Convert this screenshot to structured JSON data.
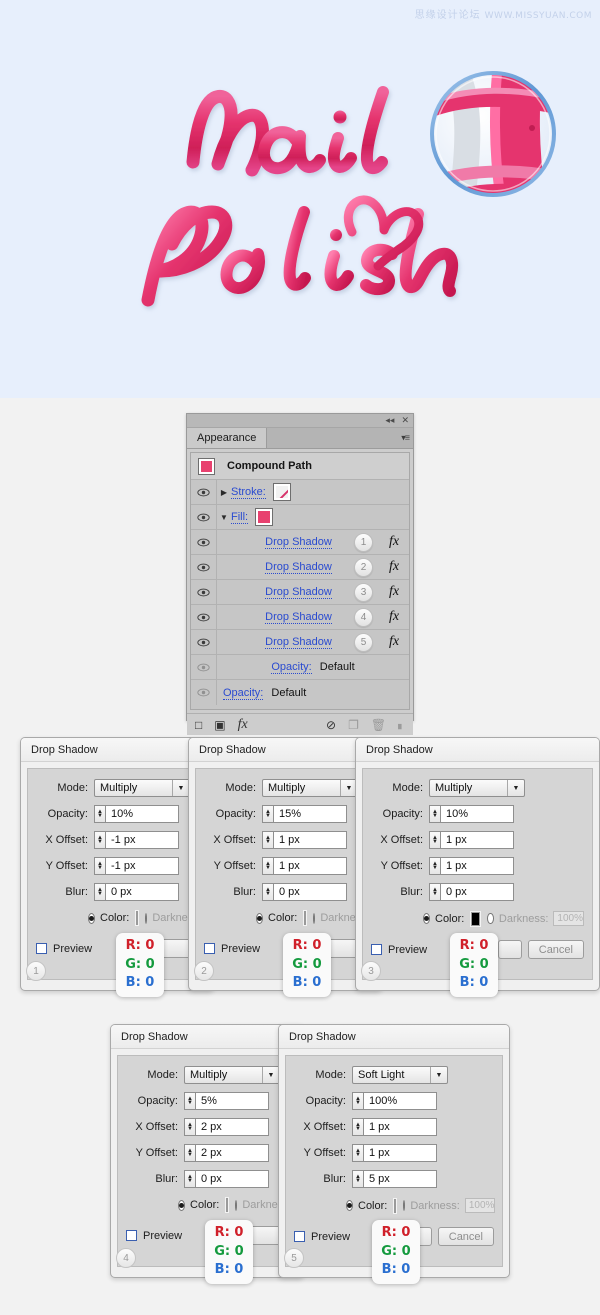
{
  "canvas": {
    "watermark_cn": "思缘设计论坛",
    "watermark_url": "WWW.MISSYUAN.COM",
    "artwork_line1": "Nail",
    "artwork_line2": "Polish",
    "background_color": "#e7effc",
    "lettering_color": "#e5346e"
  },
  "panel": {
    "tab_label": "Appearance",
    "collapse_icon": "◂◂",
    "close_icon": "✕",
    "menu_icon": "▾≡",
    "object_title": "Compound Path",
    "stroke_label": "Stroke:",
    "fill_label": "Fill:",
    "effects": [
      {
        "label": "Drop Shadow",
        "badge": "1",
        "fx": "fx"
      },
      {
        "label": "Drop Shadow",
        "badge": "2",
        "fx": "fx"
      },
      {
        "label": "Drop Shadow",
        "badge": "3",
        "fx": "fx"
      },
      {
        "label": "Drop Shadow",
        "badge": "4",
        "fx": "fx"
      },
      {
        "label": "Drop Shadow",
        "badge": "5",
        "fx": "fx"
      }
    ],
    "opacity_rows": [
      {
        "label": "Opacity:",
        "value": "Default"
      },
      {
        "label": "Opacity:",
        "value": "Default"
      }
    ],
    "footer_icons": [
      "new-stroke-icon",
      "new-fill-icon",
      "add-effect-icon",
      "clear-appearance-icon",
      "duplicate-item-icon",
      "delete-item-icon",
      "resize-grip-icon"
    ],
    "footer_glyphs": {
      "new_stroke": "□",
      "new_fill": "▣",
      "add_effect": "fx",
      "clear": "⊘",
      "duplicate": "❐",
      "delete": "Ὕ1",
      "grip": "∷"
    }
  },
  "dialog_fields": {
    "mode_label": "Mode:",
    "opacity_label": "Opacity:",
    "x_offset_label": "X Offset:",
    "y_offset_label": "Y Offset:",
    "blur_label": "Blur:",
    "color_label": "Color:",
    "darkness_label": "Darkness:",
    "preview_label": "Preview",
    "cancel_label": "Cancel",
    "darkness_value": "100%"
  },
  "dialogs": [
    {
      "num": "1",
      "title": "Drop Shadow",
      "mode": "Multiply",
      "opacity": "10%",
      "x_offset": "-1 px",
      "y_offset": "-1 px",
      "blur": "0 px",
      "color_hex": "#000000",
      "rgb": {
        "r": "R: 0",
        "g": "G: 0",
        "b": "B: 0"
      }
    },
    {
      "num": "2",
      "title": "Drop Shadow",
      "mode": "Multiply",
      "opacity": "15%",
      "x_offset": "1 px",
      "y_offset": "1 px",
      "blur": "0 px",
      "color_hex": "#000000",
      "rgb": {
        "r": "R: 0",
        "g": "G: 0",
        "b": "B: 0"
      }
    },
    {
      "num": "3",
      "title": "Drop Shadow",
      "mode": "Multiply",
      "opacity": "10%",
      "x_offset": "1 px",
      "y_offset": "1 px",
      "blur": "0 px",
      "color_hex": "#000000",
      "rgb": {
        "r": "R: 0",
        "g": "G: 0",
        "b": "B: 0"
      }
    },
    {
      "num": "4",
      "title": "Drop Shadow",
      "mode": "Multiply",
      "opacity": "5%",
      "x_offset": "2 px",
      "y_offset": "2 px",
      "blur": "0 px",
      "color_hex": "#000000",
      "rgb": {
        "r": "R: 0",
        "g": "G: 0",
        "b": "B: 0"
      }
    },
    {
      "num": "5",
      "title": "Drop Shadow",
      "mode": "Soft Light",
      "opacity": "100%",
      "x_offset": "1 px",
      "y_offset": "1 px",
      "blur": "5 px",
      "color_hex": "#000000",
      "rgb": {
        "r": "R: 0",
        "g": "G: 0",
        "b": "B: 0"
      }
    }
  ]
}
